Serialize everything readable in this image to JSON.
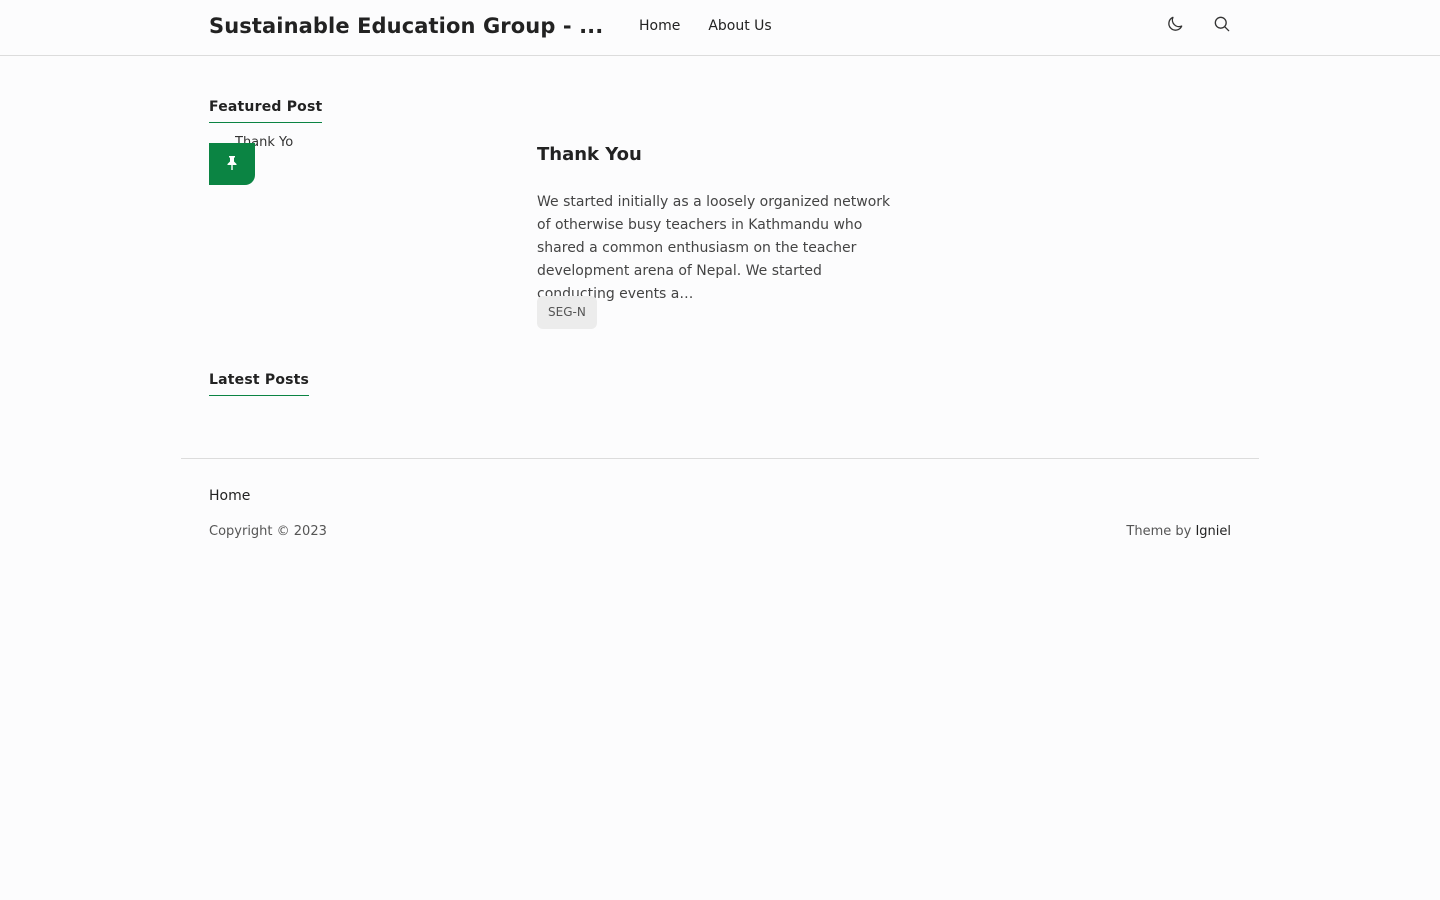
{
  "header": {
    "site_title": "Sustainable Education Group - ...",
    "nav": [
      {
        "label": "Home"
      },
      {
        "label": "About Us"
      }
    ],
    "icons": {
      "theme_toggle": "moon-icon",
      "search": "search-icon"
    }
  },
  "featured": {
    "heading": "Featured Post",
    "thumbnail_alt": "Thank You",
    "pin_icon": "pin-icon",
    "post": {
      "title": "Thank You",
      "excerpt": "We started initially as a loosely organized network of otherwise busy teachers in Kathmandu who shared a common enthusiasm on the teacher development arena of Nepal. We started conducting events a…",
      "tag": "SEG-N"
    }
  },
  "latest": {
    "heading": "Latest Posts"
  },
  "footer": {
    "home_link": "Home",
    "copyright": "Copyright © 2023",
    "theme_prefix": "Theme by ",
    "theme_author": "Igniel"
  },
  "colors": {
    "accent": "#0b8443",
    "background": "#fcfcfd",
    "text": "#222222",
    "tag_bg": "#ececec"
  }
}
